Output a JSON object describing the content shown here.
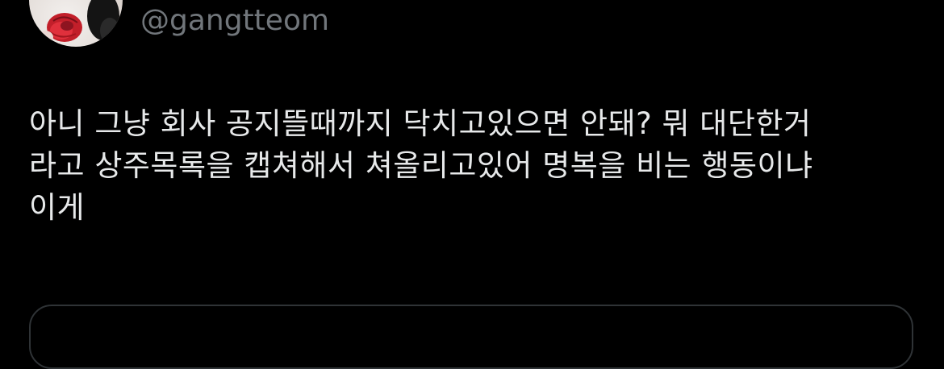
{
  "tweet": {
    "handle": "@gangtteom",
    "text_lines": [
      "아니 그냥 회사 공지뜰때까지 닥치고있으면 안돼? 뭐 대단한거",
      "라고 상주목록을 캡쳐해서 쳐올리고있어 명복을 비는 행동이냐",
      "이게"
    ]
  },
  "colors": {
    "background": "#000000",
    "text": "#e7e9ea",
    "secondary_text": "#71767b",
    "card_border": "#2f3336"
  },
  "icons": {
    "avatar": "profile-photo-red-rose"
  }
}
